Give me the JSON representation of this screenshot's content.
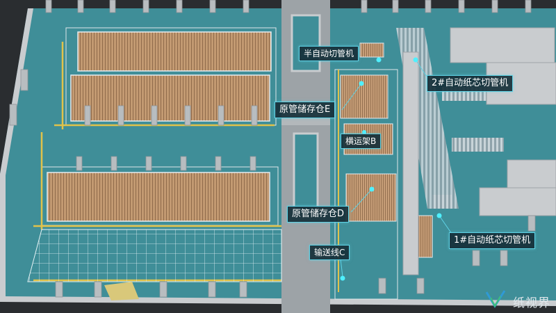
{
  "labels": {
    "semi_auto_cutter": "半自动切管机",
    "auto_cutter_2": "2#自动纸芯切管机",
    "storage_e": "原管储存仓E",
    "transfer_rack_b": "横运架B",
    "storage_d": "原管储存仓D",
    "conveyor_c": "输送线C",
    "auto_cutter_1": "1#自动纸芯切管机"
  },
  "watermark": "纸视界",
  "colors": {
    "floor": "#3f8e98",
    "wall": "#c9cccf",
    "pipe_stack": "#c39a72",
    "label_border": "#5fd3e6",
    "marker": "#4ff0ff"
  }
}
